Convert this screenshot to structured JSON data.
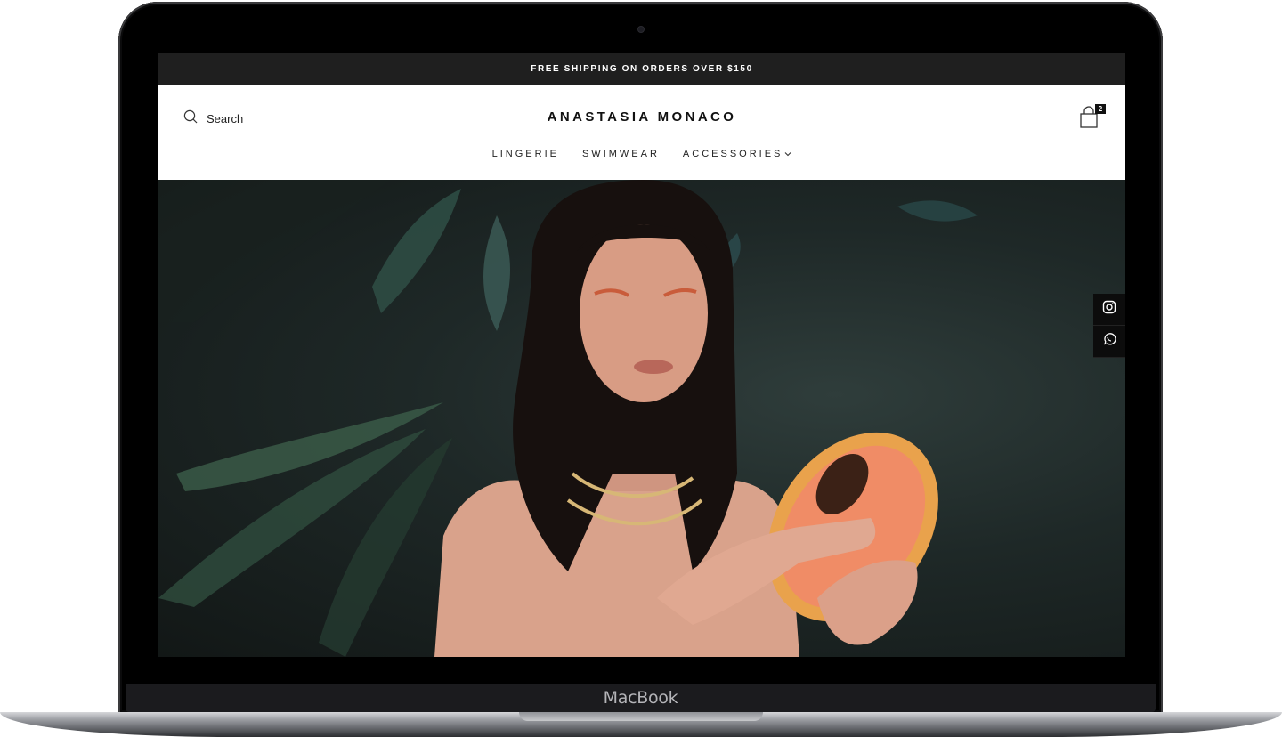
{
  "device": {
    "label": "MacBook"
  },
  "announcement": {
    "text": "FREE SHIPPING ON ORDERS OVER $150"
  },
  "header": {
    "search_label": "Search",
    "logo": "ANASTASIA MONACO",
    "cart_count": "2"
  },
  "nav": {
    "items": [
      {
        "label": "LINGERIE"
      },
      {
        "label": "SWIMWEAR"
      },
      {
        "label": "ACCESSORIES"
      }
    ]
  },
  "hero": {
    "icons": [
      "instagram-icon",
      "whatsapp-icon"
    ]
  },
  "colors": {
    "announcement_bg": "#1f1f1f",
    "social_bg": "#0c0c0c",
    "hero_bg": "#1e2827"
  }
}
